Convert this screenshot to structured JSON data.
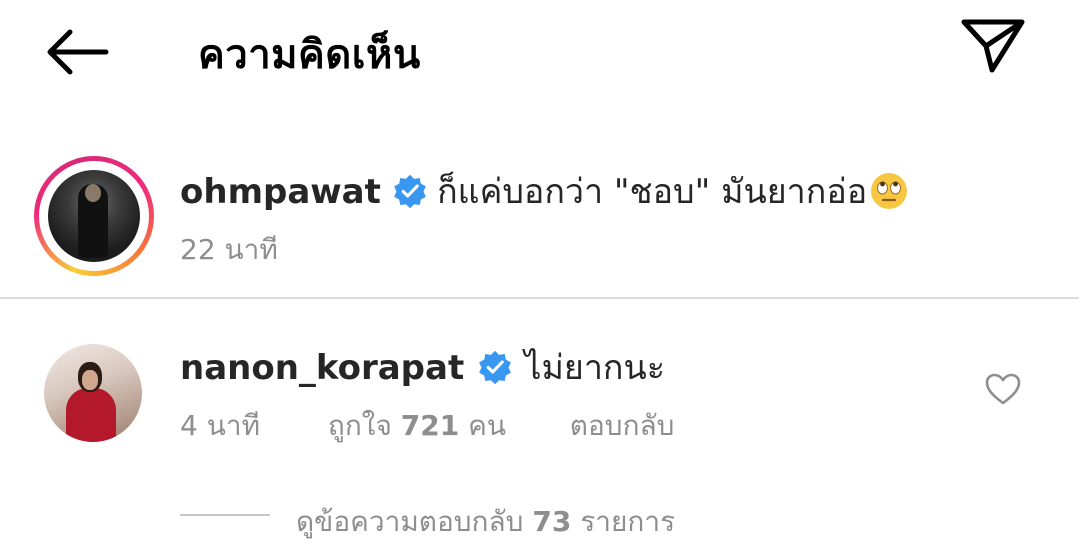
{
  "header": {
    "title": "ความคิดเห็น"
  },
  "caption": {
    "username": "ohmpawat",
    "text": "ก็แค่บอกว่า \"ชอบ\" มันยากอ่อ",
    "emoji": "rolling-eyes",
    "time": "22 นาที"
  },
  "comment": {
    "username": "nanon_korapat",
    "text": "ไม่ยากนะ",
    "time": "4 นาที",
    "likes_prefix": "ถูกใจ",
    "likes_count": "721",
    "likes_suffix": "คน",
    "reply_label": "ตอบกลับ"
  },
  "replies": {
    "prefix": "ดูข้อความตอบกลับ",
    "count": "73",
    "suffix": "รายการ"
  },
  "colors": {
    "verified": "#3897f0",
    "muted_text": "#8e8e8e",
    "divider": "#dbdbdb"
  }
}
